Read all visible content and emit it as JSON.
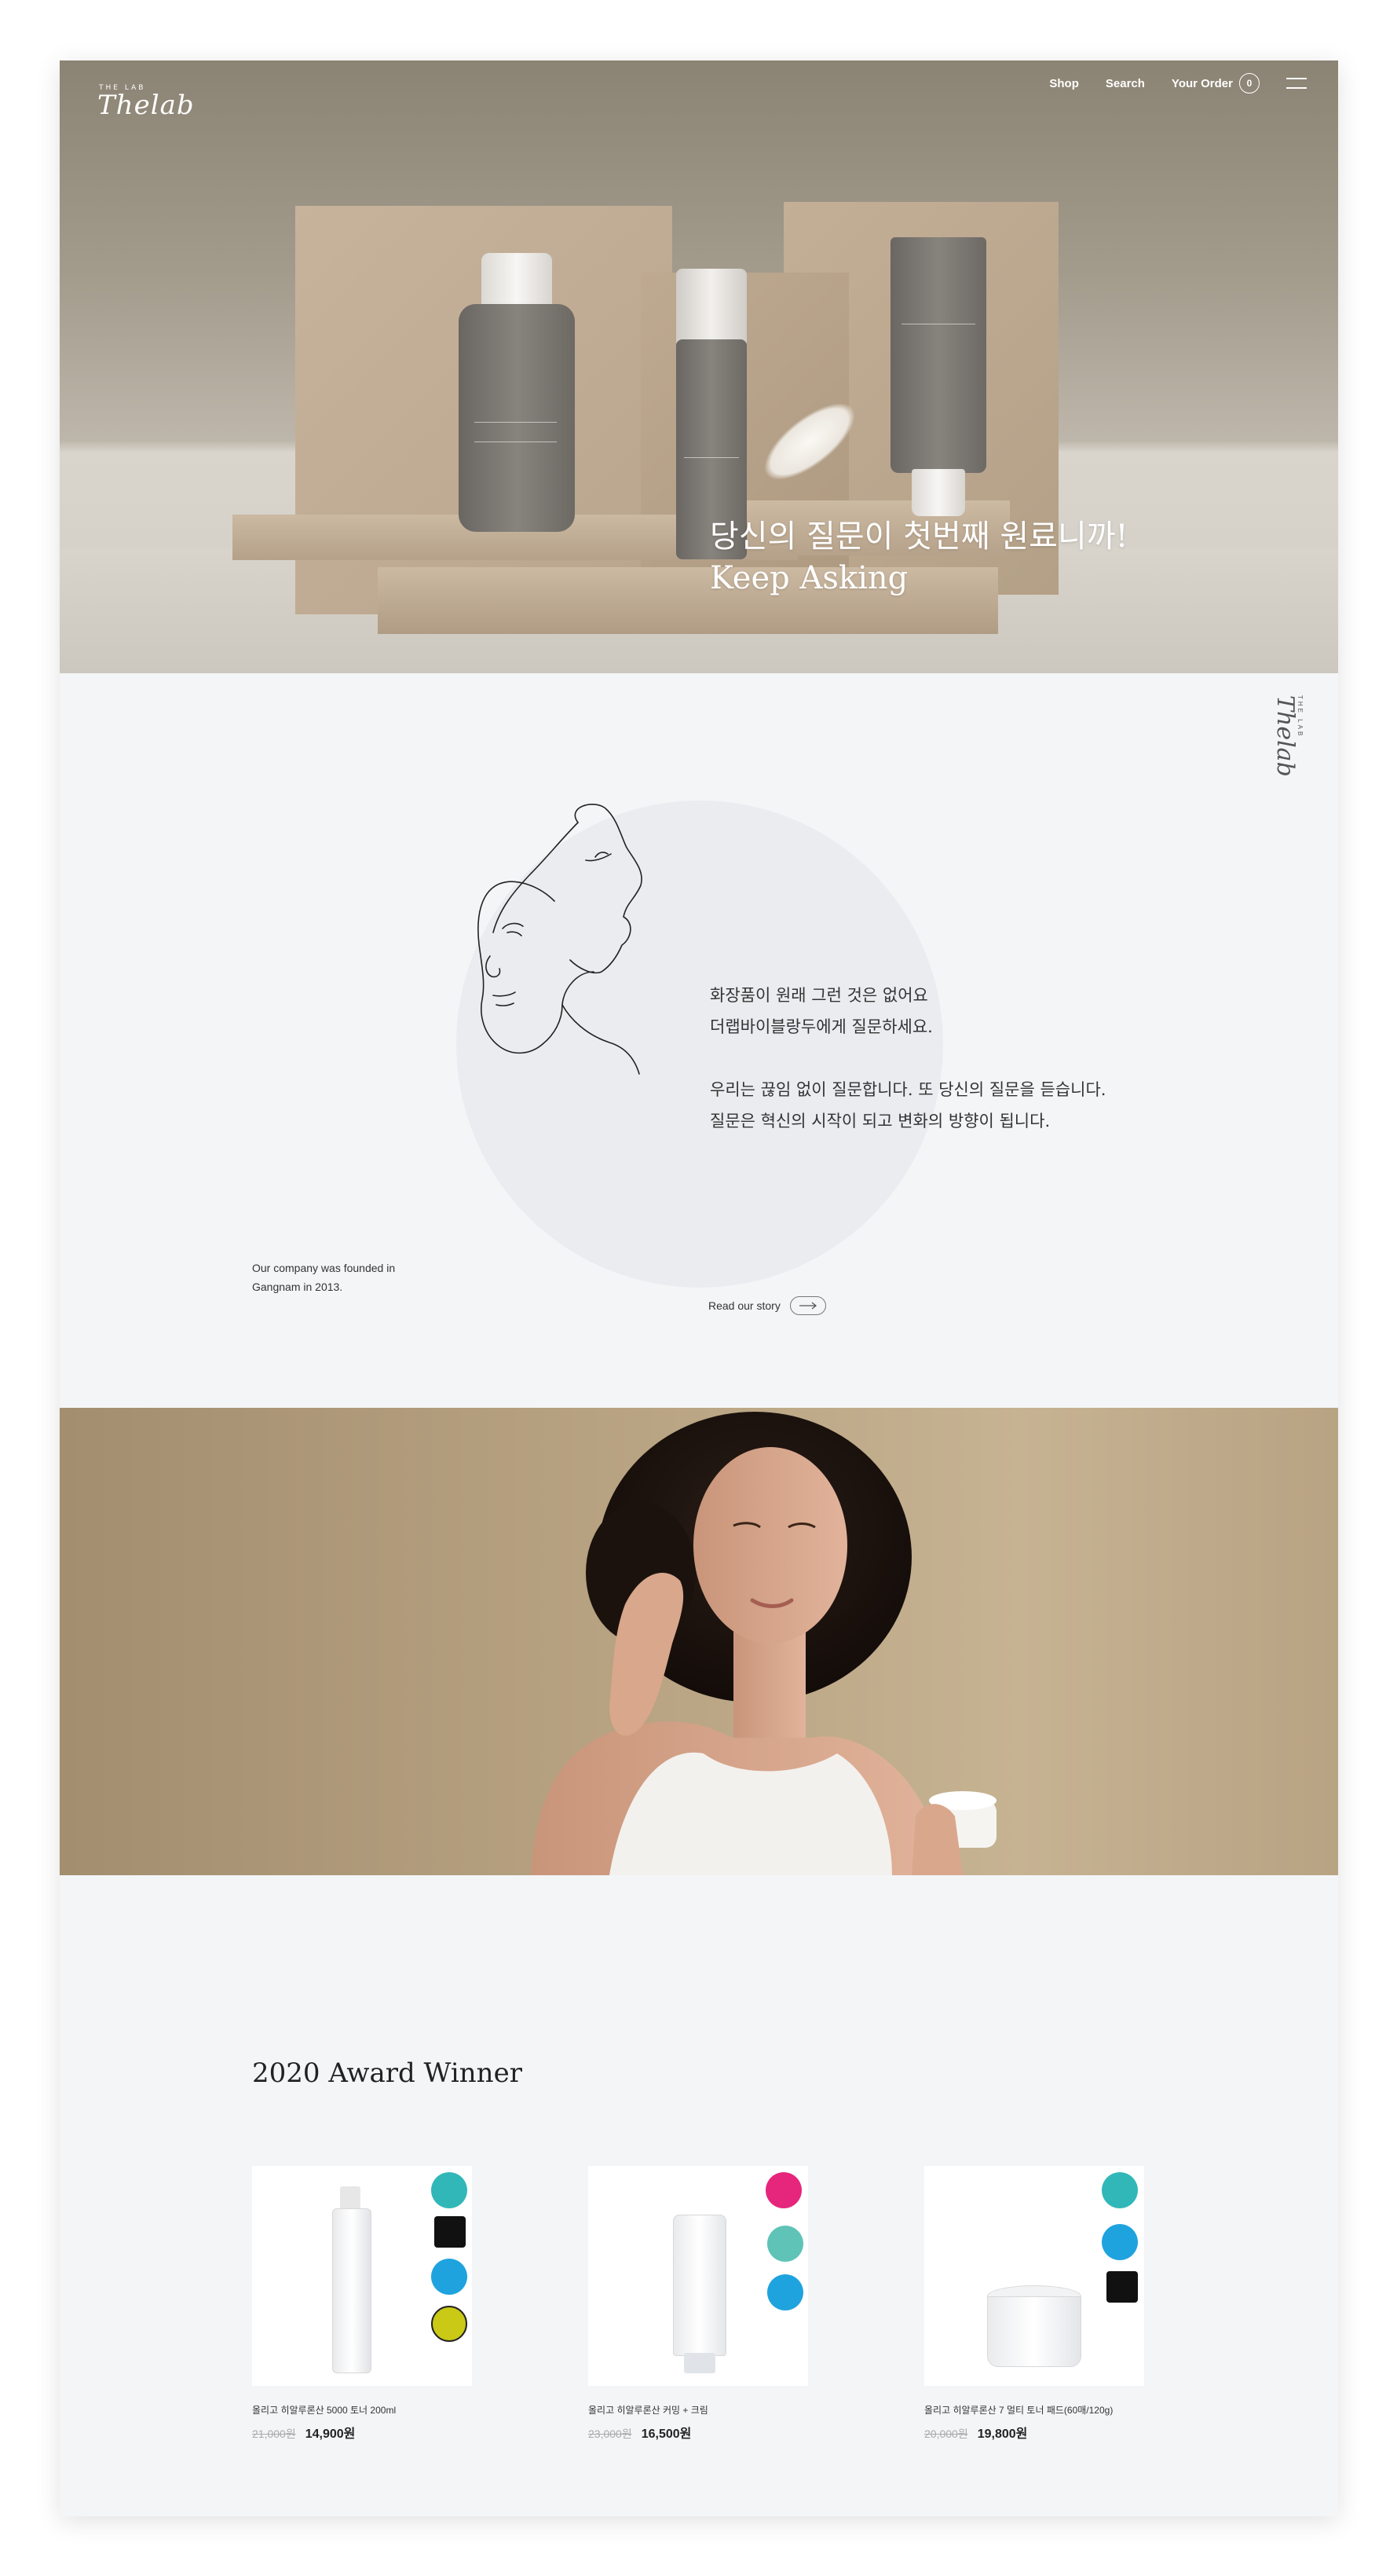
{
  "brand": {
    "small": "THE LAB",
    "script": "Thelab"
  },
  "nav": {
    "shop": "Shop",
    "search": "Search",
    "order": "Your Order",
    "order_count": "0"
  },
  "hero": {
    "title_ko": "당신의 질문이 첫번째 원료니까!",
    "title_en": "Keep Asking"
  },
  "about": {
    "line1": "화장품이 원래 그런 것은 없어요",
    "line2": "더랩바이블랑두에게 질문하세요.",
    "line3": "우리는 끊임 없이 질문합니다. 또 당신의 질문을 듣습니다.",
    "line4": "질문은 혁신의 시작이 되고 변화의 방향이 됩니다.",
    "founded": "Our company was founded in Gangnam in 2013.",
    "read_link": "Read our story"
  },
  "awards": {
    "title": "2020 Award Winner",
    "products": [
      {
        "name": "올리고 히알루론산 5000 토너 200ml",
        "old_price": "21,000원",
        "price": "14,900원"
      },
      {
        "name": "올리고 히알루론산 커밍 + 크림",
        "old_price": "23,000원",
        "price": "16,500원"
      },
      {
        "name": "올리고 히알루론산 7 멀티 토너 패드(60매/120g)",
        "old_price": "20,000원",
        "price": "19,800원"
      }
    ]
  },
  "colors": {
    "page_bg": "#f4f5f7",
    "circle": "#ebecef",
    "brand_gray": "#6d6964"
  }
}
